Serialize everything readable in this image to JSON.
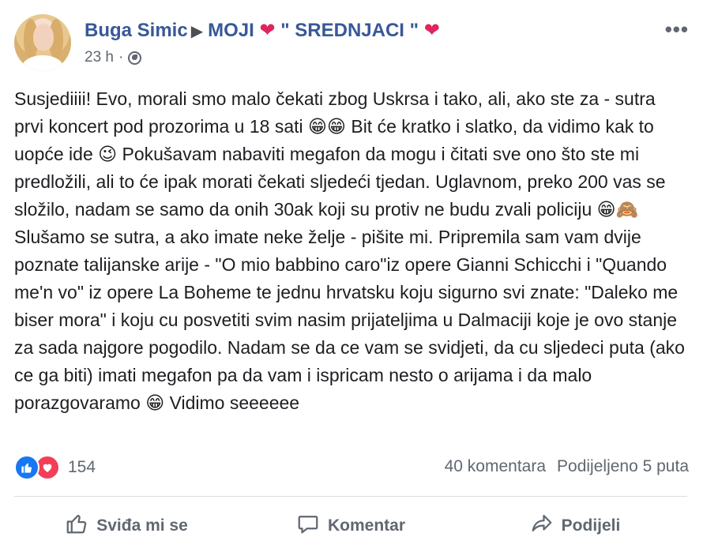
{
  "post": {
    "author": "Buga Simic",
    "group": "MOJI",
    "group_quoted": "\" SREDNJACI \"",
    "time": "23 h",
    "more_label": "•••",
    "text": "Susjediiii! Evo, morali smo malo čekati zbog Uskrsa i tako, ali, ako ste za - sutra prvi koncert pod prozorima u 18 sati 😁😁 Bit će kratko i slatko, da vidimo kak to uopće ide 😉 Pokušavam nabaviti megafon da mogu i čitati sve ono što ste mi predložili, ali to će ipak morati čekati sljedeći tjedan. Uglavnom, preko 200 vas se složilo, nadam se samo da onih 30ak koji su protiv ne budu zvali policiju 😁🙈 Slušamo se sutra, a ako imate neke želje - pišite mi. Pripremila sam vam dvije poznate talijanske arije - \"O mio babbino caro\"iz opere Gianni Schicchi i \"Quando me'n vo\" iz opere La Boheme te jednu hrvatsku koju sigurno svi znate: \"Daleko me biser mora\" i koju cu posvetiti svim nasim prijateljima u Dalmaciji koje je ovo stanje za sada najgore pogodilo. Nadam se da ce vam se svidjeti, da cu sljedeci puta (ako ce ga biti) imati megafon pa da vam i ispricam nesto o arijama i da malo porazgovaramo 😁 Vidimo seeeeee"
  },
  "reactions": {
    "count": "154",
    "types": [
      "like-icon",
      "love-icon"
    ],
    "comments": "40 komentara",
    "shares": "Podijeljeno 5 puta"
  },
  "actions": {
    "like": "Sviđa mi se",
    "comment": "Komentar",
    "share": "Podijeli"
  },
  "colors": {
    "link": "#385898",
    "like": "#1877f2",
    "love": "#f33e58",
    "muted": "#606770"
  }
}
